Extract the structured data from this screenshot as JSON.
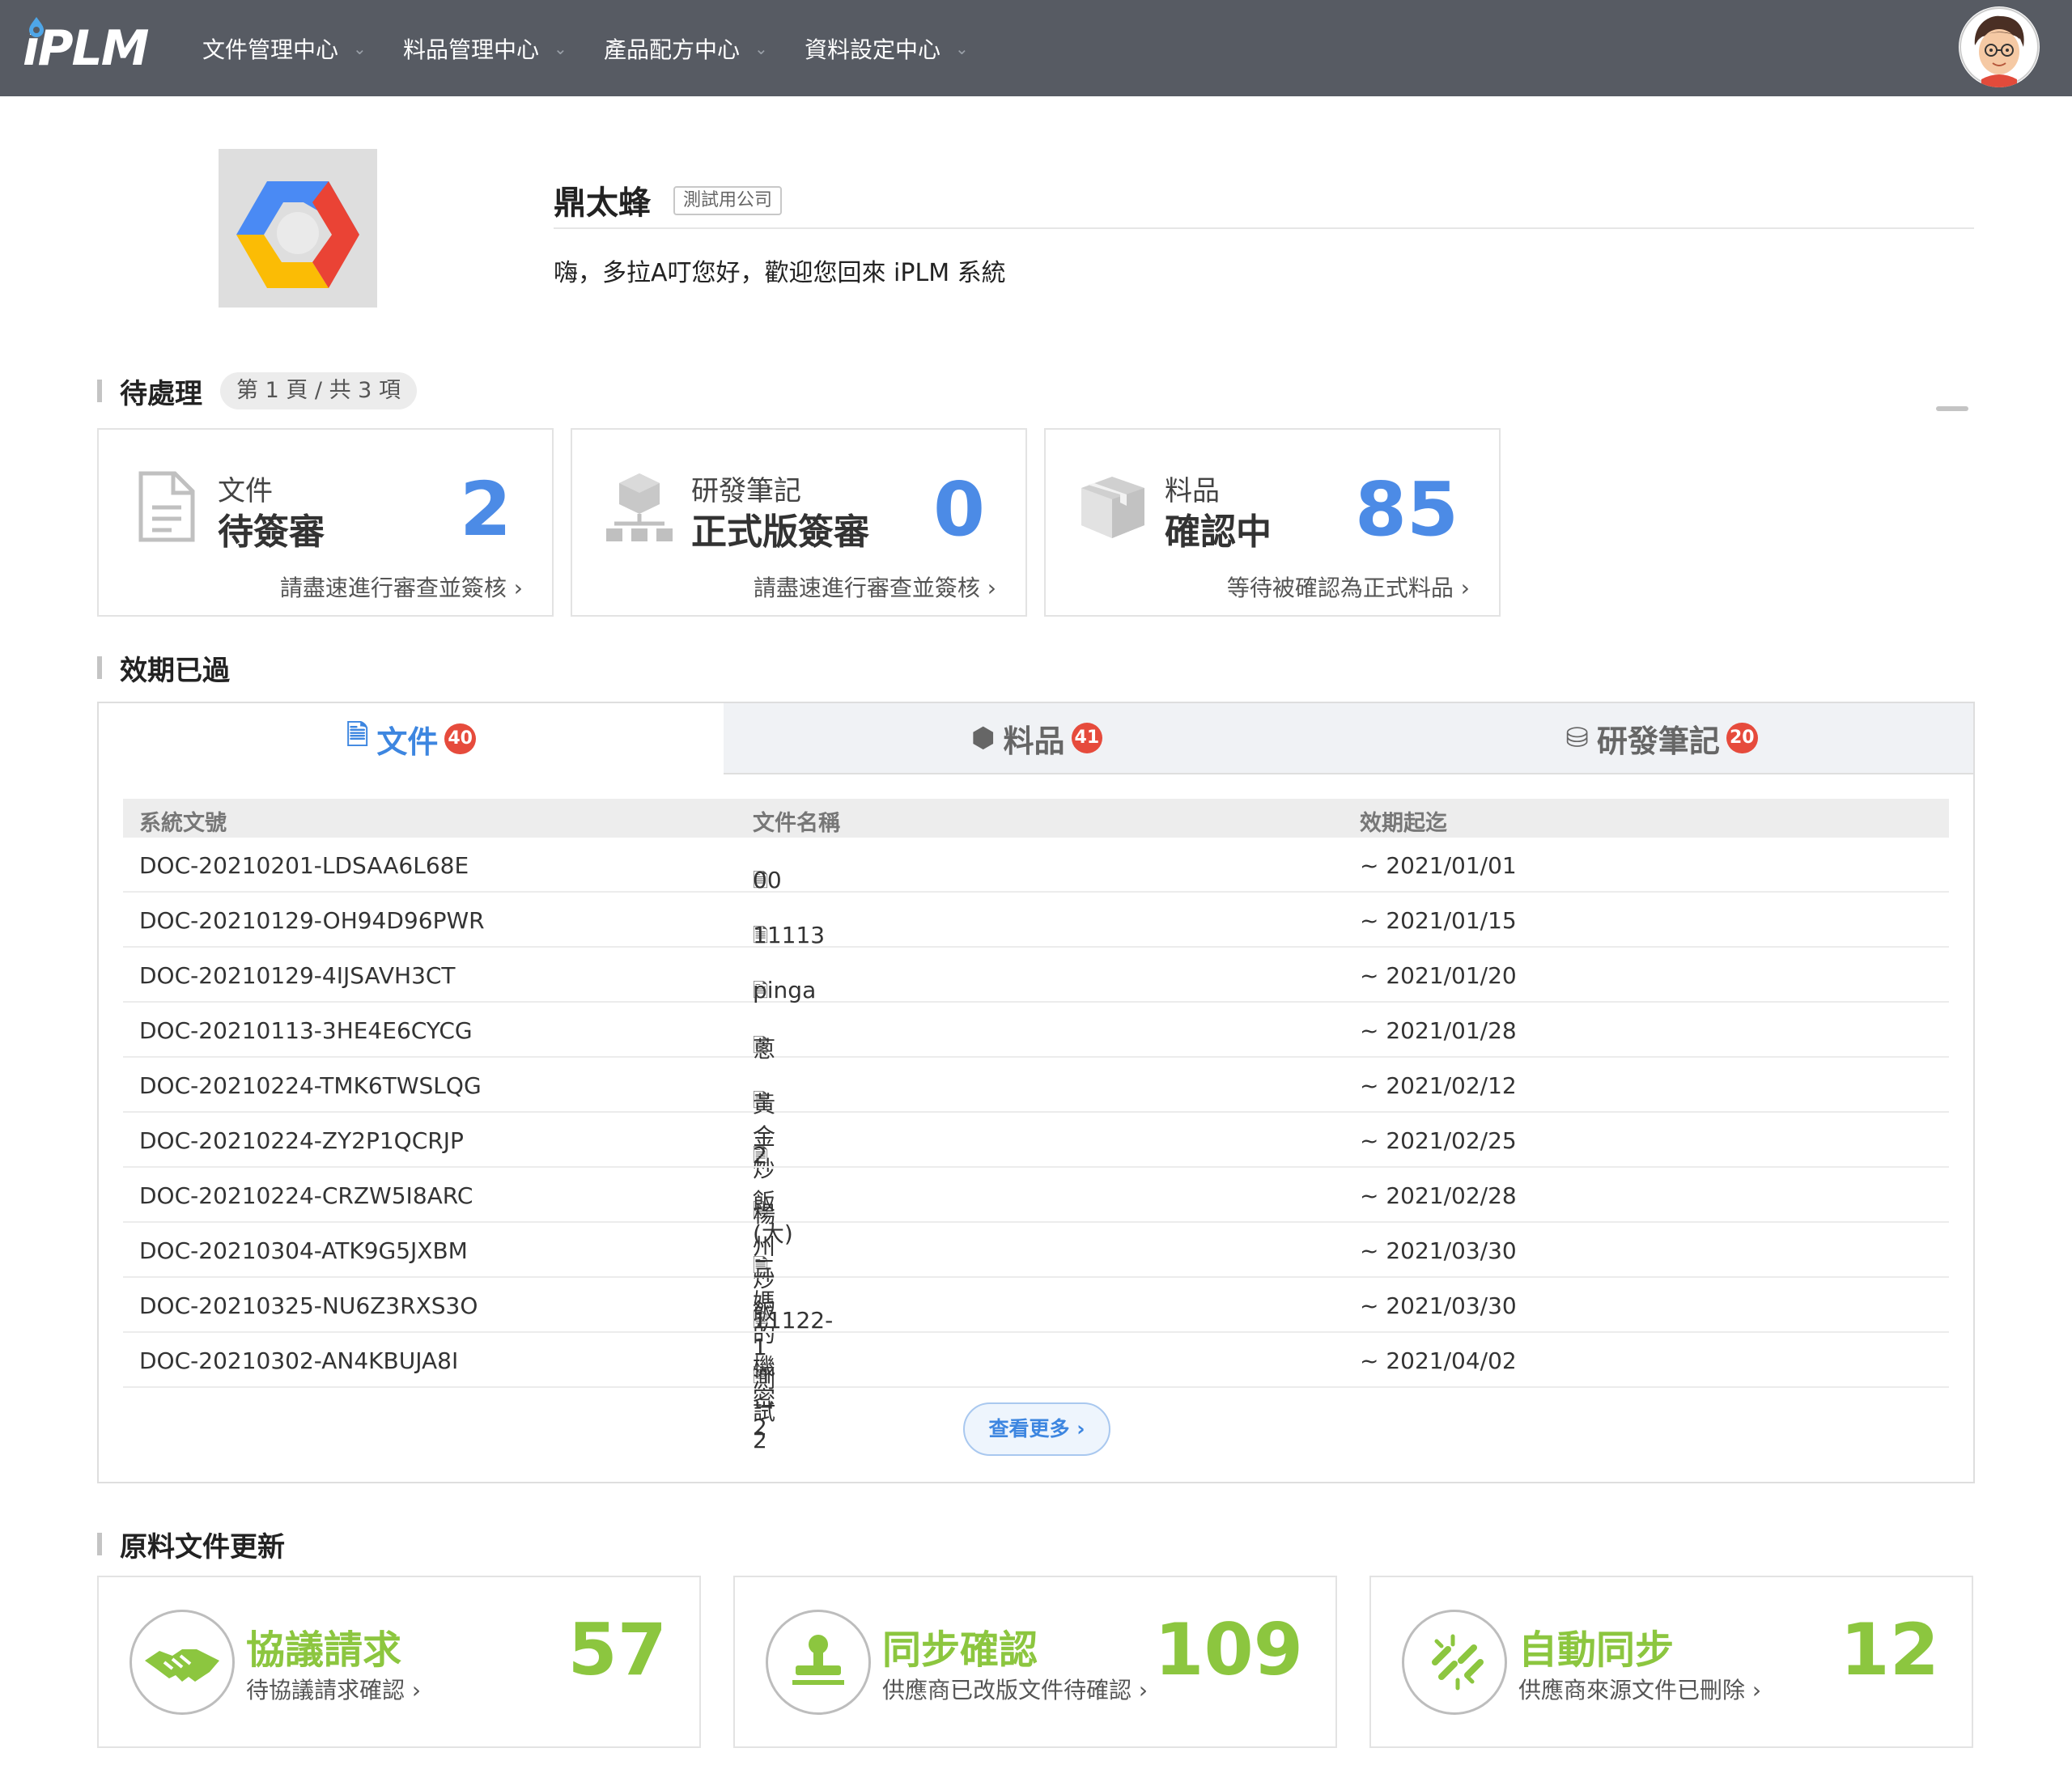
{
  "header": {
    "logo": "iPLM",
    "nav": [
      {
        "label": "文件管理中心"
      },
      {
        "label": "料品管理中心"
      },
      {
        "label": "產品配方中心"
      },
      {
        "label": "資料設定中心"
      }
    ],
    "chevron": "⌄"
  },
  "profile": {
    "company_name": "鼎太蜂",
    "company_tag": "測試用公司",
    "greeting": "嗨，多拉A叮您好，歡迎您回來 iPLM 系統"
  },
  "pending": {
    "title": "待處理",
    "page_info": "第 1 頁 / 共 3 項",
    "cards": [
      {
        "line1": "文件",
        "line2": "待簽審",
        "count": "2",
        "link": "請盡速進行審查並簽核 ›",
        "icon": "document-icon"
      },
      {
        "line1": "研發筆記",
        "line2": "正式版簽審",
        "count": "0",
        "link": "請盡速進行審查並簽核 ›",
        "icon": "rd-note-icon"
      },
      {
        "line1": "料品",
        "line2": "確認中",
        "count": "85",
        "link": "等待被確認為正式料品 ›",
        "icon": "box-icon"
      }
    ]
  },
  "expired": {
    "title": "效期已過",
    "tabs": [
      {
        "icon": "🗎",
        "label": "文件",
        "badge": "40"
      },
      {
        "icon": "⬢",
        "label": "料品",
        "badge": "41"
      },
      {
        "icon": "⛁",
        "label": "研發筆記",
        "badge": "20"
      }
    ],
    "columns": [
      "系統文號",
      "文件名稱",
      "效期起迄"
    ],
    "rows": [
      {
        "id": "DOC-20210201-LDSAA6L68E",
        "name": "00",
        "period": "~ 2021/01/01"
      },
      {
        "id": "DOC-20210129-OH94D96PWR",
        "name": "11113",
        "period": "~ 2021/01/15"
      },
      {
        "id": "DOC-20210129-4IJSAVH3CT",
        "name": "pinga",
        "period": "~ 2021/01/20"
      },
      {
        "id": "DOC-20210113-3HE4E6CYCG",
        "name": "蔥",
        "period": "~ 2021/01/28"
      },
      {
        "id": "DOC-20210224-TMK6TWSLQG",
        "name": "黃金炒飯(大)",
        "period": "~ 2021/02/12"
      },
      {
        "id": "DOC-20210224-ZY2P1QCRJP",
        "name": "2",
        "period": "~ 2021/02/25"
      },
      {
        "id": "DOC-20210224-CRZW5I8ARC",
        "name": "楊州炒飯",
        "period": "~ 2021/02/28"
      },
      {
        "id": "DOC-20210304-ATK9G5JXBM",
        "name": "三媽的機密2",
        "period": "~ 2021/03/30"
      },
      {
        "id": "DOC-20210325-NU6Z3RXS3O",
        "name": "11122-1",
        "period": "~ 2021/03/30"
      },
      {
        "id": "DOC-20210302-AN4KBUJA8I",
        "name": "測試2",
        "period": "~ 2021/04/02"
      }
    ],
    "more_label": "查看更多 ›"
  },
  "raw_update": {
    "title": "原料文件更新",
    "cards": [
      {
        "title": "協議請求",
        "subtitle": "待協議請求確認 ›",
        "count": "57",
        "icon": "handshake-icon"
      },
      {
        "title": "同步確認",
        "subtitle": "供應商已改版文件待確認 ›",
        "count": "109",
        "icon": "stamp-icon"
      },
      {
        "title": "自動同步",
        "subtitle": "供應商來源文件已刪除 ›",
        "count": "12",
        "icon": "broken-link-icon"
      }
    ]
  },
  "colors": {
    "topbar": "#575b63",
    "accent_blue": "#4c8be6",
    "accent_green": "#8cc63f",
    "badge_red": "#e64b3c"
  }
}
